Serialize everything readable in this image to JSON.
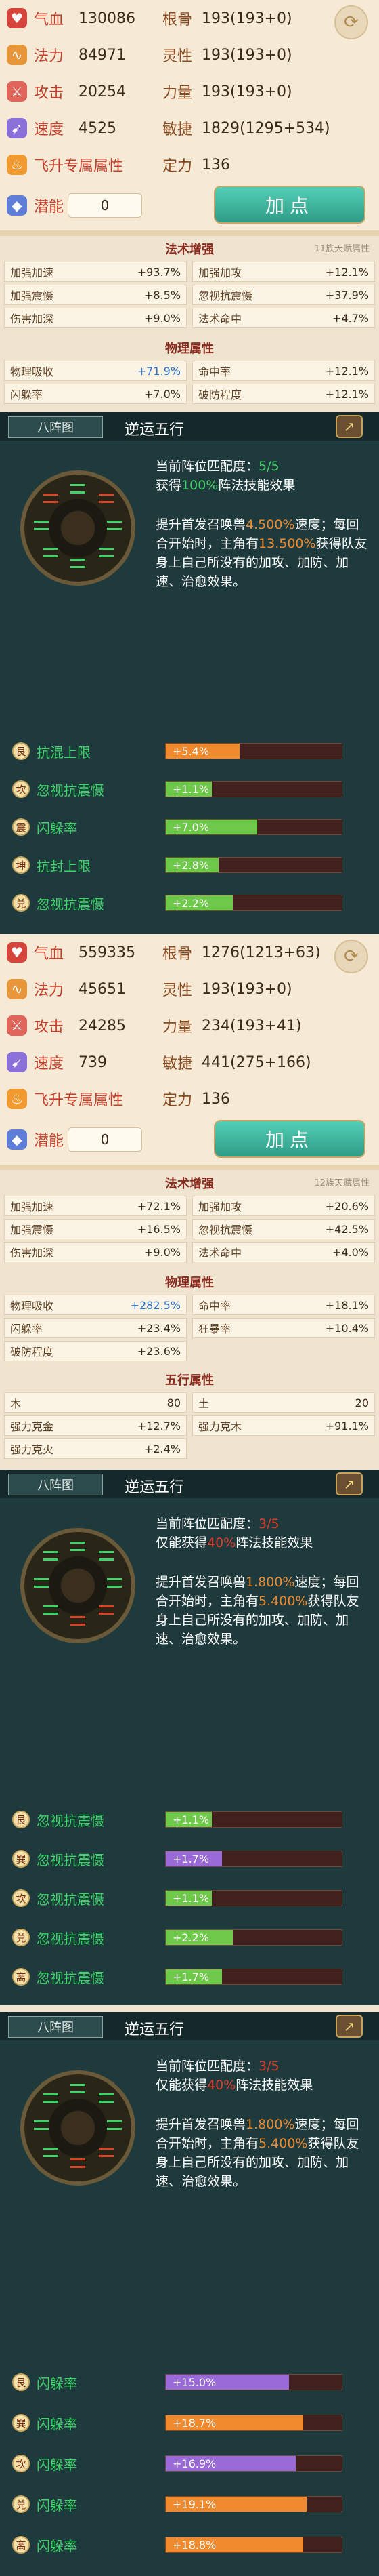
{
  "panels": [
    {
      "stats": {
        "qixue": {
          "label": "气血",
          "value": "130086"
        },
        "fali": {
          "label": "法力",
          "value": "84971"
        },
        "gongji": {
          "label": "攻击",
          "value": "20254"
        },
        "sudu": {
          "label": "速度",
          "value": "4525"
        },
        "genggu": {
          "label": "根骨",
          "value": "193(193+0)"
        },
        "lingxing": {
          "label": "灵性",
          "value": "193(193+0)"
        },
        "liliang": {
          "label": "力量",
          "value": "193(193+0)"
        },
        "minjie": {
          "label": "敏捷",
          "value": "1829(1295+534)"
        },
        "feisheng": "飞升专属属性",
        "dingli": {
          "label": "定力",
          "value": "136"
        },
        "qianneng": {
          "label": "潜能",
          "value": "0"
        },
        "add_button": "加点"
      },
      "fashu": {
        "title": "法术增强",
        "note": "11族天赋属性",
        "rows": [
          [
            {
              "k": "加强加速",
              "v": "+93.7%"
            },
            {
              "k": "加强加攻",
              "v": "+12.1%"
            }
          ],
          [
            {
              "k": "加强震慑",
              "v": "+8.5%"
            },
            {
              "k": "忽视抗震慑",
              "v": "+37.9%"
            }
          ],
          [
            {
              "k": "伤害加深",
              "v": "+9.0%"
            },
            {
              "k": "法术命中",
              "v": "+4.7%"
            }
          ]
        ]
      },
      "wuli": {
        "title": "物理属性",
        "rows": [
          [
            {
              "k": "物理吸收",
              "v": "+71.9%"
            },
            {
              "k": "命中率",
              "v": "+12.1%"
            }
          ],
          [
            {
              "k": "闪躲率",
              "v": "+7.0%"
            },
            {
              "k": "破防程度",
              "v": "+12.1%"
            }
          ]
        ]
      }
    },
    {
      "stats": {
        "qixue": {
          "label": "气血",
          "value": "559335"
        },
        "fali": {
          "label": "法力",
          "value": "45651"
        },
        "gongji": {
          "label": "攻击",
          "value": "24285"
        },
        "sudu": {
          "label": "速度",
          "value": "739"
        },
        "genggu": {
          "label": "根骨",
          "value": "1276(1213+63)"
        },
        "lingxing": {
          "label": "灵性",
          "value": "193(193+0)"
        },
        "liliang": {
          "label": "力量",
          "value": "234(193+41)"
        },
        "minjie": {
          "label": "敏捷",
          "value": "441(275+166)"
        },
        "feisheng": "飞升专属属性",
        "dingli": {
          "label": "定力",
          "value": "136"
        },
        "qianneng": {
          "label": "潜能",
          "value": "0"
        },
        "add_button": "加点"
      },
      "fashu": {
        "title": "法术增强",
        "note": "12族天赋属性",
        "rows": [
          [
            {
              "k": "加强加速",
              "v": "+72.1%"
            },
            {
              "k": "加强加攻",
              "v": "+20.6%"
            }
          ],
          [
            {
              "k": "加强震慑",
              "v": "+16.5%"
            },
            {
              "k": "忽视抗震慑",
              "v": "+42.5%"
            }
          ],
          [
            {
              "k": "伤害加深",
              "v": "+9.0%"
            },
            {
              "k": "法术命中",
              "v": "+4.0%"
            }
          ]
        ]
      },
      "wuli": {
        "title": "物理属性",
        "rows": [
          [
            {
              "k": "物理吸收",
              "v": "+282.5%"
            },
            {
              "k": "命中率",
              "v": "+18.1%"
            }
          ],
          [
            {
              "k": "闪躲率",
              "v": "+23.4%"
            },
            {
              "k": "狂暴率",
              "v": "+10.4%"
            }
          ],
          [
            {
              "k": "破防程度",
              "v": "+23.6%"
            }
          ]
        ]
      },
      "wuxing": {
        "title": "五行属性",
        "rows": [
          [
            {
              "k": "木",
              "v": "80"
            },
            {
              "k": "土",
              "v": "20"
            }
          ],
          [
            {
              "k": "强力克金",
              "v": "+12.7%"
            },
            {
              "k": "强力克木",
              "v": "+91.1%"
            }
          ],
          [
            {
              "k": "强力克火",
              "v": "+2.4%"
            }
          ]
        ]
      }
    }
  ],
  "formations": [
    {
      "tab": "八阵图",
      "name": "逆运五行",
      "line1a": "当前阵位匹配度：",
      "line1b": "5/5",
      "line2a": "获得",
      "line2b": "100%",
      "line2c": "阵法技能效果",
      "desc1": "提升首发召唤兽",
      "desc1b": "4.500%",
      "desc1c": "速度；每回合开始时，主角有",
      "desc2": "13.500%",
      "desc2b": "获得队友身上自己所没有的加攻、加防、加速、治愈效果。",
      "rows": [
        {
          "badge": "艮",
          "label": "抗混上限",
          "value": "+5.4%",
          "fill": 0.42,
          "color": "orange"
        },
        {
          "badge": "坎",
          "label": "忽视抗震慑",
          "value": "+1.1%",
          "fill": 0.26,
          "color": "green"
        },
        {
          "badge": "震",
          "label": "闪躲率",
          "value": "+7.0%",
          "fill": 0.52,
          "color": "green"
        },
        {
          "badge": "坤",
          "label": "抗封上限",
          "value": "+2.8%",
          "fill": 0.3,
          "color": "green"
        },
        {
          "badge": "兑",
          "label": "忽视抗震慑",
          "value": "+2.2%",
          "fill": 0.38,
          "color": "green"
        }
      ]
    },
    {
      "tab": "八阵图",
      "name": "逆运五行",
      "line1a": "当前阵位匹配度：",
      "line1b": "3/5",
      "line2a": "仅能获得",
      "line2b": "40%",
      "line2c": "阵法技能效果",
      "desc1": "提升首发召唤兽",
      "desc1b": "1.800%",
      "desc1c": "速度；每回合开始时，主角有",
      "desc2": "5.400%",
      "desc2b": "获得队友身上自己所没有的加攻、加防、加速、治愈效果。",
      "rows": [
        {
          "badge": "艮",
          "label": "忽视抗震慑",
          "value": "+1.1%",
          "fill": 0.26,
          "color": "green"
        },
        {
          "badge": "巽",
          "label": "忽视抗震慑",
          "value": "+1.7%",
          "fill": 0.32,
          "color": "purple"
        },
        {
          "badge": "坎",
          "label": "忽视抗震慑",
          "value": "+1.1%",
          "fill": 0.26,
          "color": "green"
        },
        {
          "badge": "兑",
          "label": "忽视抗震慑",
          "value": "+2.2%",
          "fill": 0.38,
          "color": "green"
        },
        {
          "badge": "离",
          "label": "忽视抗震慑",
          "value": "+1.7%",
          "fill": 0.32,
          "color": "green"
        }
      ]
    },
    {
      "tab": "八阵图",
      "name": "逆运五行",
      "line1a": "当前阵位匹配度：",
      "line1b": "3/5",
      "line2a": "仅能获得",
      "line2b": "40%",
      "line2c": "阵法技能效果",
      "desc1": "提升首发召唤兽",
      "desc1b": "1.800%",
      "desc1c": "速度；每回合开始时，主角有",
      "desc2": "5.400%",
      "desc2b": "获得队友身上自己所没有的加攻、加防、加速、治愈效果。",
      "rows": [
        {
          "badge": "艮",
          "label": "闪躲率",
          "value": "+15.0%",
          "fill": 0.7,
          "color": "purple"
        },
        {
          "badge": "巽",
          "label": "闪躲率",
          "value": "+18.7%",
          "fill": 0.78,
          "color": "orange"
        },
        {
          "badge": "坎",
          "label": "闪躲率",
          "value": "+16.9%",
          "fill": 0.74,
          "color": "purple"
        },
        {
          "badge": "兑",
          "label": "闪躲率",
          "value": "+19.1%",
          "fill": 0.8,
          "color": "orange"
        },
        {
          "badge": "离",
          "label": "闪躲率",
          "value": "+18.8%",
          "fill": 0.78,
          "color": "orange"
        }
      ]
    }
  ]
}
